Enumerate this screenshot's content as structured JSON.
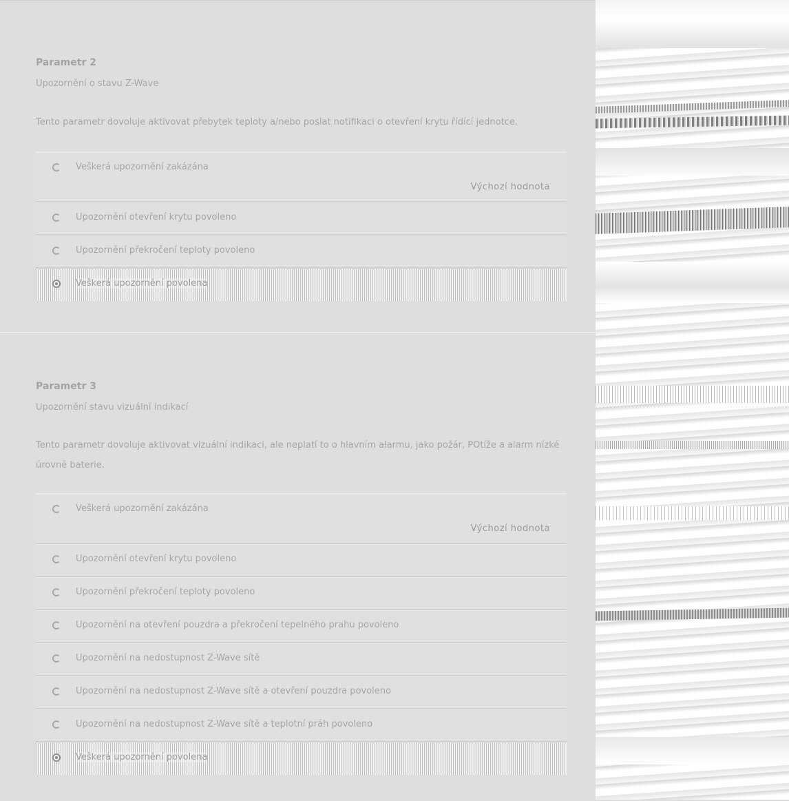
{
  "parameters": [
    {
      "title": "Parametr 2",
      "subtitle": "Upozornění o stavu Z-Wave",
      "description": "Tento parametr dovoluje aktivovat přebytek teploty a/nebo poslat notifikaci o otevření krytu řídící jednotce.",
      "default_label": "Výchozí hodnota",
      "options": [
        "Veškerá upozornění zakázána",
        "Upozornění otevření krytu povoleno",
        "Upozornění překročení teploty povoleno",
        "Veškerá upozornění povolena"
      ],
      "selected_index": 3
    },
    {
      "title": "Parametr 3",
      "subtitle": "Upozornění stavu vizuální indikací",
      "description": "Tento parametr dovoluje aktivovat vizuální indikaci, ale neplatí to o hlavním alarmu, jako požár, POtíže a alarm nízké úrovně baterie.",
      "default_label": "Výchozí hodnota",
      "options": [
        "Veškerá upozornění zakázána",
        "Upozornění otevření krytu povoleno",
        "Upozornění překročení teploty povoleno",
        "Upozornění na otevření pouzdra a překročení tepelného prahu povoleno",
        "Upozornění na nedostupnost Z-Wave sítě",
        "Upozornění na nedostupnost Z-Wave sítě a otevření pouzdra povoleno",
        "Upozornění na nedostupnost Z-Wave sítě a teplotní práh povoleno",
        "Veškerá upozornění povolena"
      ],
      "selected_index": 7
    }
  ]
}
